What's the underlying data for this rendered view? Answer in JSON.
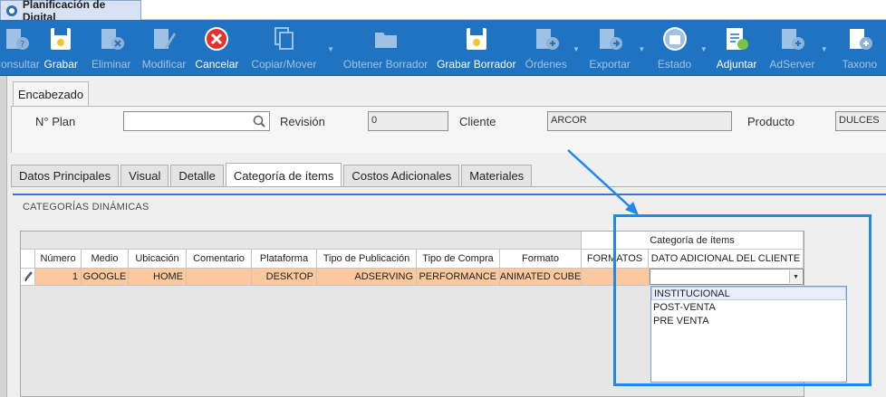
{
  "window": {
    "title": "Planificación de Digital"
  },
  "toolbar": {
    "buttons": [
      {
        "label": "Consultar",
        "icon": "query-icon",
        "active": false
      },
      {
        "label": "Grabar",
        "icon": "save-icon",
        "active": true
      },
      {
        "label": "Eliminar",
        "icon": "delete-icon",
        "active": false
      },
      {
        "label": "Modificar",
        "icon": "edit-icon",
        "active": false
      },
      {
        "label": "Cancelar",
        "icon": "cancel-icon",
        "active": true
      },
      {
        "label": "Copiar/Mover",
        "icon": "copy-icon",
        "active": false
      },
      {
        "label": "Obtener Borrador",
        "icon": "folder-icon",
        "active": false
      },
      {
        "label": "Grabar Borrador",
        "icon": "save-draft-icon",
        "active": true
      },
      {
        "label": "Órdenes",
        "icon": "orders-icon",
        "active": false
      },
      {
        "label": "Exportar",
        "icon": "export-icon",
        "active": false
      },
      {
        "label": "Estado",
        "icon": "status-icon",
        "active": false
      },
      {
        "label": "Adjuntar",
        "icon": "attach-icon",
        "active": true
      },
      {
        "label": "AdServer",
        "icon": "adserver-icon",
        "active": false
      },
      {
        "label": "Taxono",
        "icon": "taxonomy-icon",
        "active": false
      }
    ]
  },
  "header": {
    "tab_label": "Encabezado",
    "plan_label": "N° Plan",
    "plan_value": "",
    "revision_label": "Revisión",
    "revision_value": "0",
    "client_label": "Cliente",
    "client_value": "ARCOR",
    "product_label": "Producto",
    "product_value": "DULCES"
  },
  "tabs": [
    {
      "label": "Datos Principales",
      "active": false
    },
    {
      "label": "Visual",
      "active": false
    },
    {
      "label": "Detalle",
      "active": false
    },
    {
      "label": "Categoría de ítems",
      "active": true
    },
    {
      "label": "Costos Adicionales",
      "active": false
    },
    {
      "label": "Materiales",
      "active": false
    }
  ],
  "section": {
    "title": "CATEGORÍAS DINÁMICAS"
  },
  "grid": {
    "group_header": "Categoría de ítems",
    "columns": [
      "Número",
      "Medio",
      "Ubicación",
      "Comentario",
      "Plataforma",
      "Tipo de Publicación",
      "Tipo de Compra",
      "Formato",
      "FORMATOS",
      "DATO ADICIONAL DEL CLIENTE"
    ],
    "row": {
      "numero": "1",
      "medio": "GOOGLE",
      "ubicacion": "HOME",
      "comentario": "",
      "plataforma": "DESKTOP",
      "tipo_publicacion": "ADSERVING",
      "tipo_compra": "PERFORMANCE",
      "formato": "ANIMATED CUBE",
      "formatos": "",
      "dato_adicional": ""
    }
  },
  "dropdown": {
    "options": [
      "INSTITUCIONAL",
      "POST-VENTA",
      "PRE VENTA"
    ],
    "highlighted": "INSTITUCIONAL"
  },
  "colors": {
    "toolbar_bg": "#1f73c0",
    "row_highlight": "#fcc89e",
    "annotation": "#1e88f0",
    "cancel_red": "#e2322c"
  }
}
